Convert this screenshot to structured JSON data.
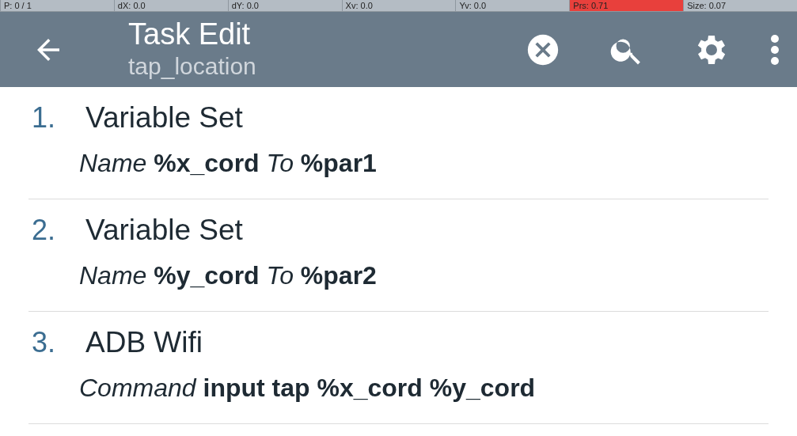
{
  "pointer_strip": [
    {
      "text": "P: 0 / 1",
      "highlighted": false
    },
    {
      "text": "dX: 0.0",
      "highlighted": false
    },
    {
      "text": "dY: 0.0",
      "highlighted": false
    },
    {
      "text": "Xv: 0.0",
      "highlighted": false
    },
    {
      "text": "Yv: 0.0",
      "highlighted": false
    },
    {
      "text": "Prs: 0.71",
      "highlighted": true
    },
    {
      "text": "Size: 0.07",
      "highlighted": false
    }
  ],
  "toolbar": {
    "title": "Task Edit",
    "subtitle": "tap_location"
  },
  "actions": [
    {
      "number": "1.",
      "name": "Variable Set",
      "params": "*Name* **%x_cord** *To* **%par1**"
    },
    {
      "number": "2.",
      "name": "Variable Set",
      "params": "*Name* **%y_cord** *To* **%par2**"
    },
    {
      "number": "3.",
      "name": "ADB Wifi",
      "params": "*Command* **input tap %x_cord %y_cord**"
    }
  ]
}
